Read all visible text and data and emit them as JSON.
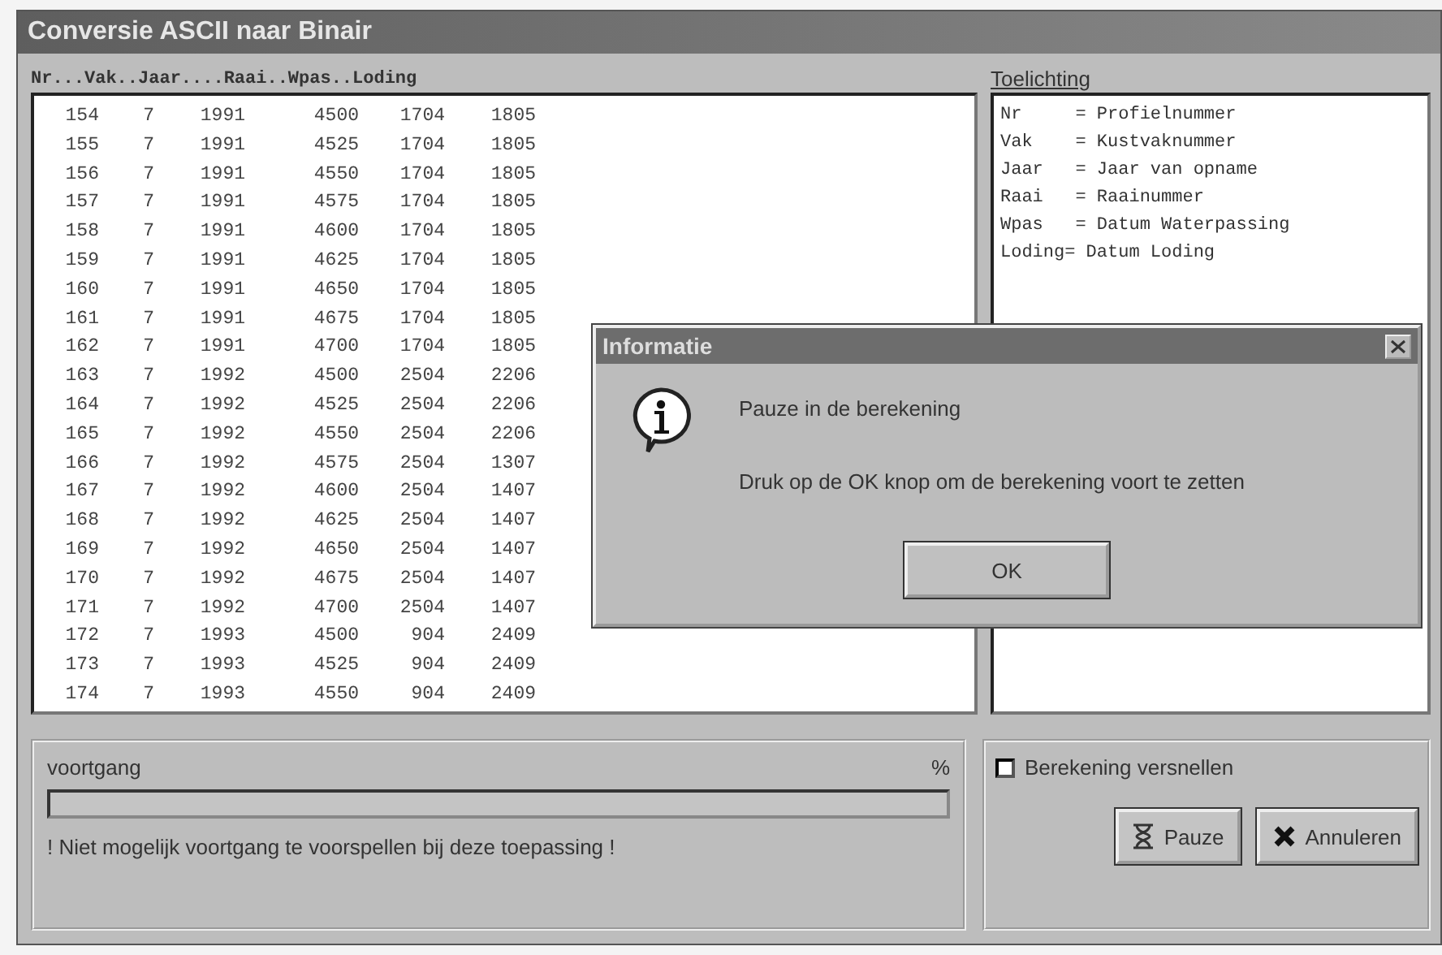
{
  "window": {
    "title": "Conversie ASCII naar Binair"
  },
  "list": {
    "header": "Nr...Vak..Jaar....Raai..Wpas..Loding",
    "rows": [
      [
        "154",
        "7",
        "1991",
        "4500",
        "1704",
        "1805"
      ],
      [
        "155",
        "7",
        "1991",
        "4525",
        "1704",
        "1805"
      ],
      [
        "156",
        "7",
        "1991",
        "4550",
        "1704",
        "1805"
      ],
      [
        "157",
        "7",
        "1991",
        "4575",
        "1704",
        "1805"
      ],
      [
        "158",
        "7",
        "1991",
        "4600",
        "1704",
        "1805"
      ],
      [
        "159",
        "7",
        "1991",
        "4625",
        "1704",
        "1805"
      ],
      [
        "160",
        "7",
        "1991",
        "4650",
        "1704",
        "1805"
      ],
      [
        "161",
        "7",
        "1991",
        "4675",
        "1704",
        "1805"
      ],
      [
        "162",
        "7",
        "1991",
        "4700",
        "1704",
        "1805"
      ],
      [
        "163",
        "7",
        "1992",
        "4500",
        "2504",
        "2206"
      ],
      [
        "164",
        "7",
        "1992",
        "4525",
        "2504",
        "2206"
      ],
      [
        "165",
        "7",
        "1992",
        "4550",
        "2504",
        "2206"
      ],
      [
        "166",
        "7",
        "1992",
        "4575",
        "2504",
        "1307"
      ],
      [
        "167",
        "7",
        "1992",
        "4600",
        "2504",
        "1407"
      ],
      [
        "168",
        "7",
        "1992",
        "4625",
        "2504",
        "1407"
      ],
      [
        "169",
        "7",
        "1992",
        "4650",
        "2504",
        "1407"
      ],
      [
        "170",
        "7",
        "1992",
        "4675",
        "2504",
        "1407"
      ],
      [
        "171",
        "7",
        "1992",
        "4700",
        "2504",
        "1407"
      ],
      [
        "172",
        "7",
        "1993",
        "4500",
        "904",
        "2409"
      ],
      [
        "173",
        "7",
        "1993",
        "4525",
        "904",
        "2409"
      ],
      [
        "174",
        "7",
        "1993",
        "4550",
        "904",
        "2409"
      ]
    ]
  },
  "legend": {
    "title": "Toelichting",
    "lines": [
      "Nr     = Profielnummer",
      "Vak    = Kustvaknummer",
      "Jaar   = Jaar van opname",
      "Raai   = Raainummer",
      "Wpas   = Datum Waterpassing",
      "Loding= Datum Loding"
    ]
  },
  "progress": {
    "label": "voortgang",
    "unit": "%",
    "note": "! Niet mogelijk voortgang te voorspellen bij deze toepassing !"
  },
  "options": {
    "checkbox": {
      "label": "Berekening versnellen",
      "checked": false
    },
    "buttons": [
      {
        "label": "Pauze",
        "kind": "pause"
      },
      {
        "label": "Annuleren",
        "kind": "cancel"
      }
    ]
  },
  "dialog": {
    "title": "Informatie",
    "lines": [
      "Pauze in de berekening",
      "Druk op de OK knop om de berekening voort te zetten"
    ],
    "button": "OK"
  }
}
